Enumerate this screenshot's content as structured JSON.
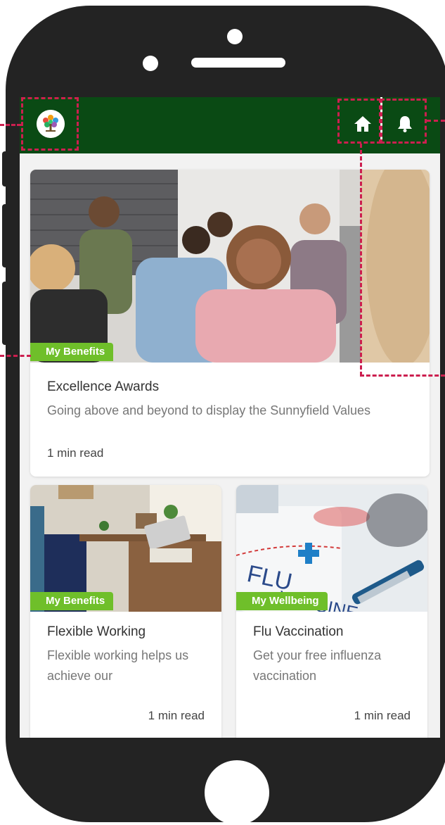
{
  "app": {
    "brand": "Sunnyfield",
    "header_color": "#0a4a14",
    "accent_color": "#6fbf2a",
    "annotation_color": "#cc1f4f"
  },
  "appbar": {
    "logo_icon": "tree-logo-icon",
    "home_icon": "home-icon",
    "bell_icon": "bell-icon"
  },
  "feature_card": {
    "tag": "My Benefits",
    "title": "Excellence Awards",
    "description": "Going above and beyond to display the Sunnyfield Values",
    "meta": "1 min read"
  },
  "cards": [
    {
      "tag": "My Benefits",
      "title": "Flexible Working",
      "description": "Flexible working helps us achieve our",
      "meta": "1 min read"
    },
    {
      "tag": "My Wellbeing",
      "title": "Flu Vaccination",
      "description": "Get your free influenza vaccination",
      "meta": "1 min read"
    }
  ]
}
